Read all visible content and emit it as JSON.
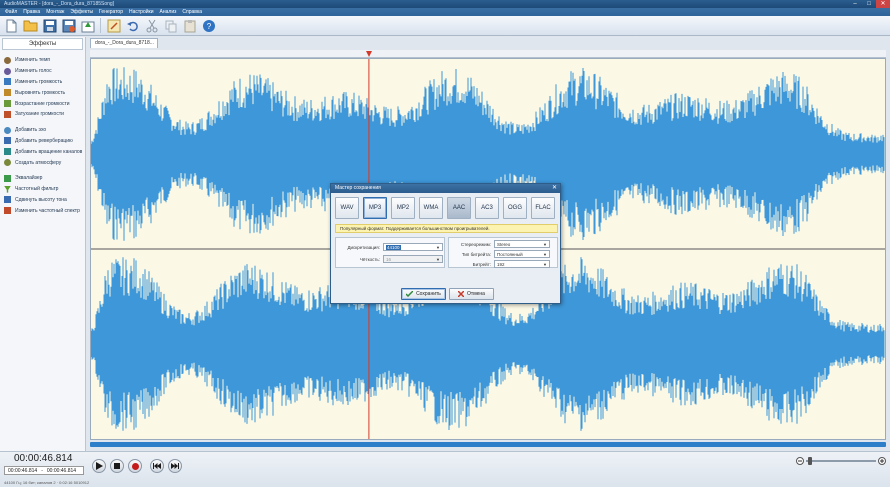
{
  "window": {
    "title": "AudioMASTER - [dora_-_Dora_dura_87185Song]",
    "min_label": "–",
    "max_label": "□",
    "close_label": "✕"
  },
  "menu": [
    "Файл",
    "Правка",
    "Монтаж",
    "Эффекты",
    "Генератор",
    "Настройки",
    "Анализ",
    "Справка"
  ],
  "toolbar": {
    "icons": [
      "new-file-icon",
      "open-folder-icon",
      "save-icon",
      "save-as-icon",
      "export-icon",
      "edit-icon",
      "undo-icon",
      "cut-icon",
      "copy-icon",
      "paste-icon",
      "help-icon"
    ]
  },
  "sidebar": {
    "title": "Эффекты",
    "items": [
      {
        "label": "Изменить темп",
        "color": "#8a6a3a"
      },
      {
        "label": "Изменить голос",
        "color": "#6a5a9a"
      },
      {
        "label": "Изменить громкость",
        "color": "#3a7ac0"
      },
      {
        "label": "Выровнять громкость",
        "color": "#c08a2a"
      },
      {
        "label": "Возрастание громкости",
        "color": "#6a9a3a"
      },
      {
        "label": "Затухание громкости",
        "color": "#c0502a"
      },
      {
        "label": "Добавить эхо",
        "color": "#4a8ac0"
      },
      {
        "label": "Добавить реверберацию",
        "color": "#3a6ab0"
      },
      {
        "label": "Добавить вращение каналов",
        "color": "#2a8a8a"
      },
      {
        "label": "Создать атмосферу",
        "color": "#7a8a3a"
      },
      {
        "label": "Эквалайзер",
        "color": "#3a9a4a"
      },
      {
        "label": "Частотный фильтр",
        "color": "#5aa02a"
      },
      {
        "label": "Сдвинуть высоту тона",
        "color": "#3a6ab0"
      },
      {
        "label": "Изменить частотный спектр",
        "color": "#c04a2a"
      }
    ]
  },
  "document": {
    "tab_label": "dora_-_Dora_dura_8718..."
  },
  "colors": {
    "wave": "#3d97d8",
    "canvas_bg": "#fbf8e6",
    "cursor": "#d43a2a"
  },
  "playback": {
    "position_fraction": 0.35
  },
  "dialog": {
    "title": "Мастер сохранения",
    "close_label": "✕",
    "formats": [
      "WAV",
      "MP3",
      "MP2",
      "WMA",
      "AAC",
      "AC3",
      "OGG",
      "FLAC"
    ],
    "selected_format": "MP3",
    "info": "Популярный формат. Поддерживается большинством проигрывателей.",
    "sampling_label": "Дискретизация:",
    "sampling_value": "44100",
    "clarity_label": "Чёткость:",
    "clarity_value": "16",
    "stereo_label": "Стереорежим:",
    "stereo_value": "Stereo",
    "bitrate_type_label": "Тип битрейта:",
    "bitrate_type_value": "Постоянный",
    "bitrate_label": "Битрейт:",
    "bitrate_value": "192",
    "save_button": "Сохранить",
    "cancel_button": "Отмена"
  },
  "bottom": {
    "time": "00:00:46.814",
    "sel_start": "00:00:46.814",
    "sel_sep": "-",
    "sel_end": "00:00:46.814",
    "status": "44100 Гц; 16 бит; каналов 2 · 0:02:16 5010912"
  }
}
